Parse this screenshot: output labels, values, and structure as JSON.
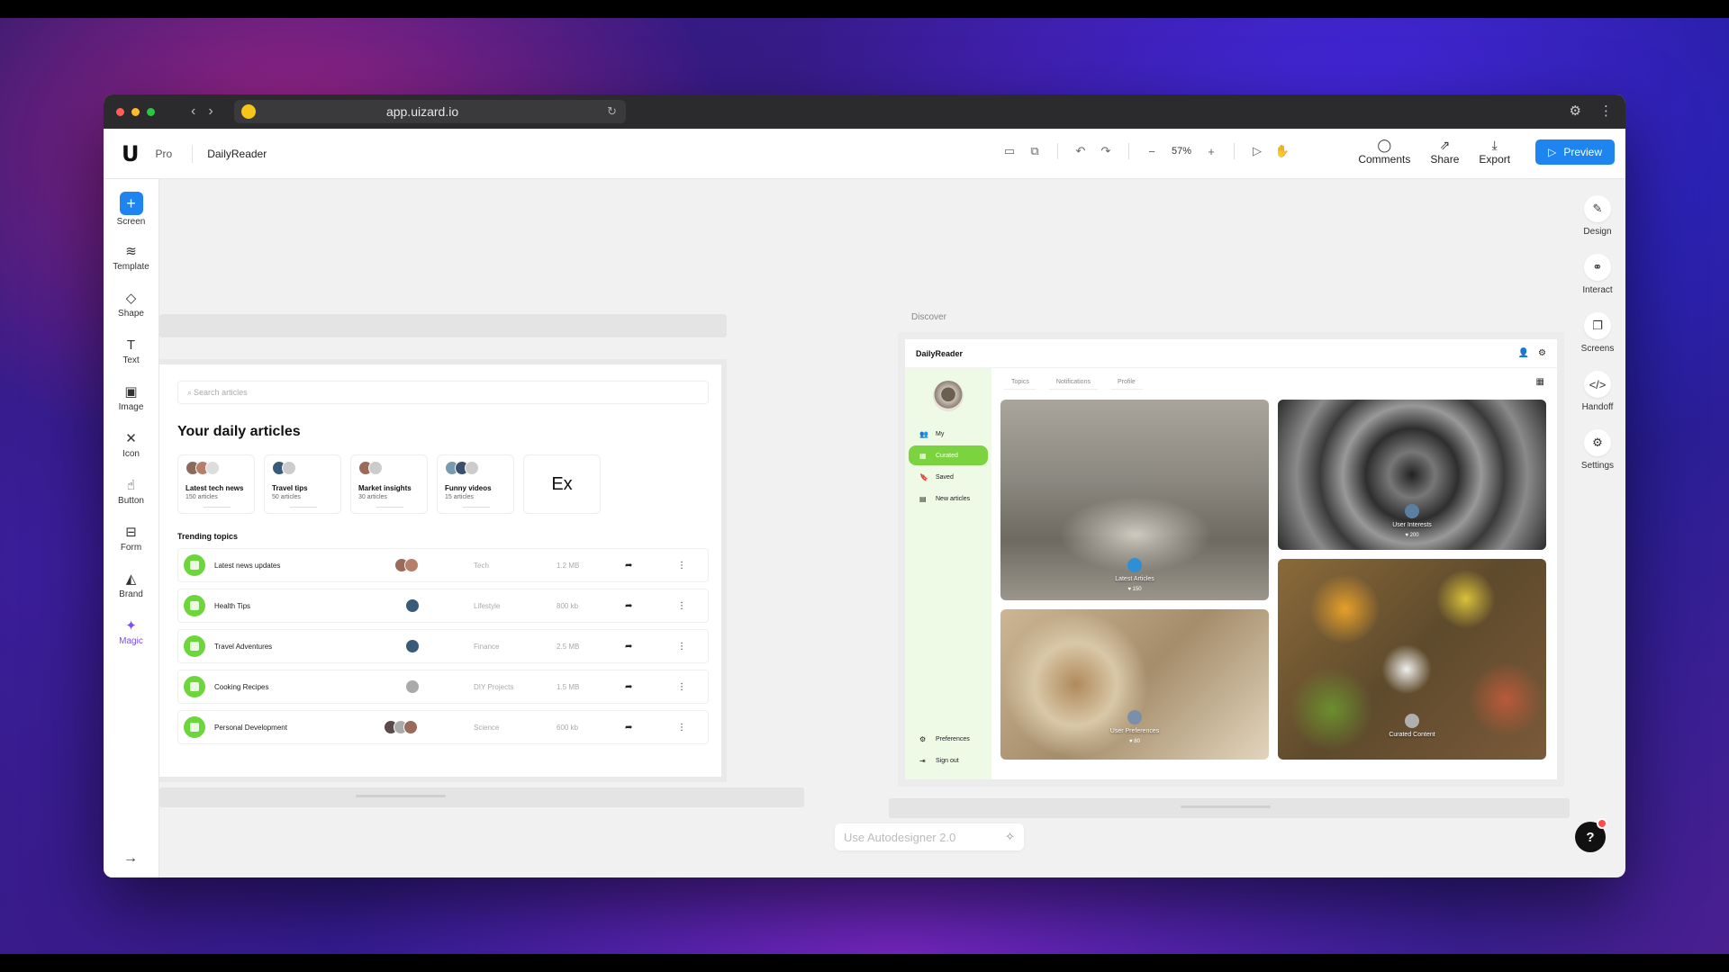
{
  "browser": {
    "url": "app.uizard.io"
  },
  "toolbar": {
    "logo": "U",
    "plan_badge": "Pro",
    "project_name": "DailyReader",
    "zoom": "57%",
    "actions": [
      {
        "label": "Comments",
        "icon": "comment-icon"
      },
      {
        "label": "Share",
        "icon": "share-icon"
      },
      {
        "label": "Export",
        "icon": "export-icon"
      }
    ],
    "preview_label": "Preview",
    "accent_color": "#1d84f0"
  },
  "left_tools": [
    {
      "label": "Screen",
      "icon": "plus-icon"
    },
    {
      "label": "Template",
      "icon": "layers-icon"
    },
    {
      "label": "Shape",
      "icon": "shape-icon"
    },
    {
      "label": "Text",
      "icon": "text-icon"
    },
    {
      "label": "Image",
      "icon": "image-icon"
    },
    {
      "label": "Icon",
      "icon": "icon-icon"
    },
    {
      "label": "Button",
      "icon": "button-icon"
    },
    {
      "label": "Form",
      "icon": "form-icon"
    },
    {
      "label": "Brand",
      "icon": "brand-icon"
    },
    {
      "label": "Magic",
      "icon": "magic-icon"
    }
  ],
  "right_tools": [
    {
      "label": "Design",
      "icon": "pencil-icon"
    },
    {
      "label": "Interact",
      "icon": "link-icon"
    },
    {
      "label": "Screens",
      "icon": "screens-icon"
    },
    {
      "label": "Handoff",
      "icon": "code-icon"
    },
    {
      "label": "Settings",
      "icon": "gear-icon"
    }
  ],
  "screen1": {
    "search_placeholder": "Search articles",
    "title": "Your daily articles",
    "categories": [
      {
        "title": "Latest tech news",
        "count": "150 articles"
      },
      {
        "title": "Travel tips",
        "count": "50 articles"
      },
      {
        "title": "Market insights",
        "count": "30 articles"
      },
      {
        "title": "Funny videos",
        "count": "15 articles"
      }
    ],
    "extra_card": "Ex",
    "trending_title": "Trending topics",
    "trending": [
      {
        "name": "Latest news updates",
        "tag": "Tech",
        "size": "1.2 MB"
      },
      {
        "name": "Health Tips",
        "tag": "Lifestyle",
        "size": "800 kb"
      },
      {
        "name": "Travel Adventures",
        "tag": "Finance",
        "size": "2.5 MB"
      },
      {
        "name": "Cooking Recipes",
        "tag": "DIY Projects",
        "size": "1.5 MB"
      },
      {
        "name": "Personal Development",
        "tag": "Science",
        "size": "600 kb"
      }
    ]
  },
  "screen2": {
    "frame_label": "Discover",
    "brand": "DailyReader",
    "nav": [
      {
        "label": "My",
        "icon": "user-icon"
      },
      {
        "label": "Curated",
        "icon": "grid-icon"
      },
      {
        "label": "Saved",
        "icon": "bookmark-icon"
      },
      {
        "label": "New articles",
        "icon": "news-icon"
      }
    ],
    "bottom_nav": [
      {
        "label": "Preferences",
        "icon": "gear-icon"
      },
      {
        "label": "Sign out",
        "icon": "signout-icon"
      }
    ],
    "tabs": [
      "Topics",
      "Notifications",
      "Profile"
    ],
    "tiles": [
      {
        "caption": "Latest Articles",
        "count": "♥ 150"
      },
      {
        "caption": "User Interests",
        "count": "♥ 200"
      },
      {
        "caption": "User Preferences",
        "count": "♥ 80"
      },
      {
        "caption": "Curated Content",
        "count": ""
      }
    ],
    "active_color": "#7ad33f"
  },
  "autodesigner": {
    "placeholder": "Use Autodesigner 2.0"
  },
  "help": {
    "label": "?"
  }
}
